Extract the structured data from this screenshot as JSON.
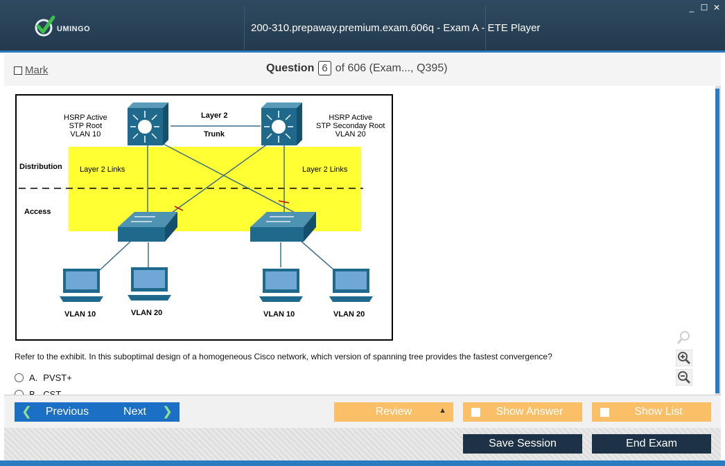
{
  "window": {
    "title": "200-310.prepaway.premium.exam.606q - Exam A - ETE Player",
    "logo_text": "UMINGO",
    "controls": [
      "_",
      "☐",
      "✕"
    ]
  },
  "question_bar": {
    "mark_label": "Mark",
    "question_label": "Question",
    "question_number": "6",
    "question_total": "of 606 (Exam..., Q395)"
  },
  "exhibit": {
    "labels": {
      "left_switch": [
        "HSRP Active",
        "STP Root",
        "VLAN 10"
      ],
      "right_switch": [
        "HSRP Active",
        "STP Seconday Root",
        "VLAN 20"
      ],
      "layer2": "Layer 2",
      "trunk": "Trunk",
      "distribution": "Distribution",
      "access": "Access",
      "l2_links_left": "Layer 2 Links",
      "l2_links_right": "Layer 2 Links",
      "vlans": [
        "VLAN 10",
        "VLAN 20",
        "VLAN 10",
        "VLAN 20"
      ]
    }
  },
  "question": {
    "stem": "Refer to the exhibit. In this suboptimal design of a homogeneous Cisco network, which version of spanning tree provides the fastest convergence?",
    "options": [
      {
        "letter": "A.",
        "text": "PVST+"
      },
      {
        "letter": "B.",
        "text": "CST"
      }
    ]
  },
  "nav": {
    "previous": "Previous",
    "next": "Next",
    "review": "Review",
    "show_answer": "Show Answer",
    "show_list": "Show List",
    "save_session": "Save Session",
    "end_exam": "End Exam"
  },
  "icons": [
    "checkmark-logo-icon",
    "search-icon",
    "zoom-in-icon",
    "zoom-out-icon",
    "chevron-left-icon",
    "chevron-right-icon",
    "triangle-up-icon"
  ],
  "colors": {
    "title_bg": "#2f4a60",
    "accent": "#2b7bbf",
    "nav_blue": "#1b6fc4",
    "orange": "#fbbf68",
    "dark": "#1d3247",
    "exhibit_yellow": "#ffff33",
    "device_blue": "#1f6a8c"
  }
}
